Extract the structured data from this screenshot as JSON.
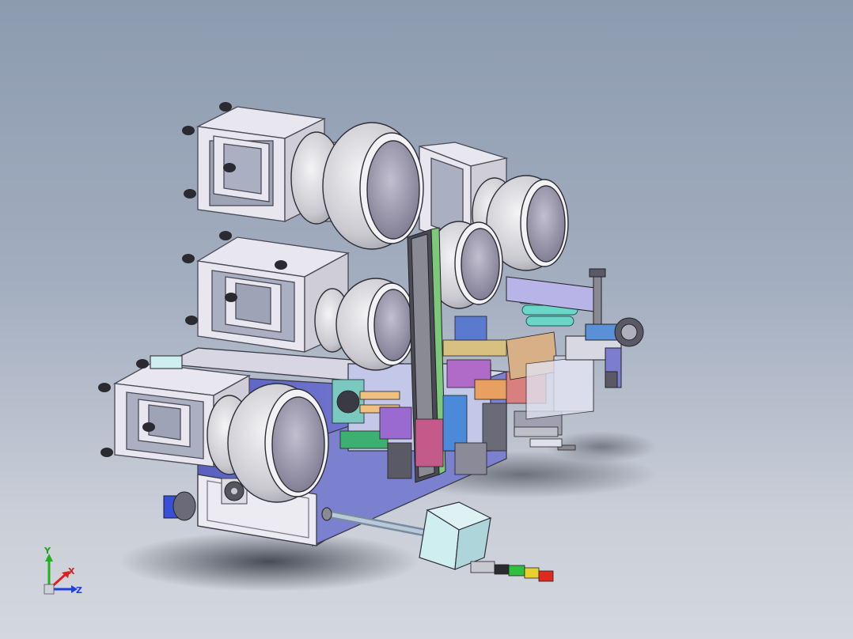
{
  "viewport": {
    "background_top": "#8d9bb0",
    "background_bottom": "#d4d7de"
  },
  "colors": {
    "frame": "#e8e6ee",
    "frame_edge": "#4a4a55",
    "bowl": "#dcdce0",
    "bowl_inner": "#8e8ca0",
    "cabinet": "#6a70c8",
    "panel": "#ecebf2",
    "tower_box": "#cfeef0",
    "triad_x": "#e02020",
    "triad_y": "#20b020",
    "triad_z": "#2040e0"
  },
  "components": {
    "feeder_frames": [
      "feeder-frame-upper-left",
      "feeder-frame-upper-right",
      "feeder-frame-middle",
      "feeder-frame-lower"
    ],
    "bowl_feeders": [
      "bowl-feeder-top-large",
      "bowl-feeder-top-right",
      "bowl-feeder-center",
      "bowl-feeder-middle",
      "bowl-feeder-lower"
    ],
    "signal_tower_segments": [
      "green",
      "yellow",
      "red"
    ]
  },
  "triad": {
    "x_label": "X",
    "y_label": "Y",
    "z_label": "Z"
  }
}
